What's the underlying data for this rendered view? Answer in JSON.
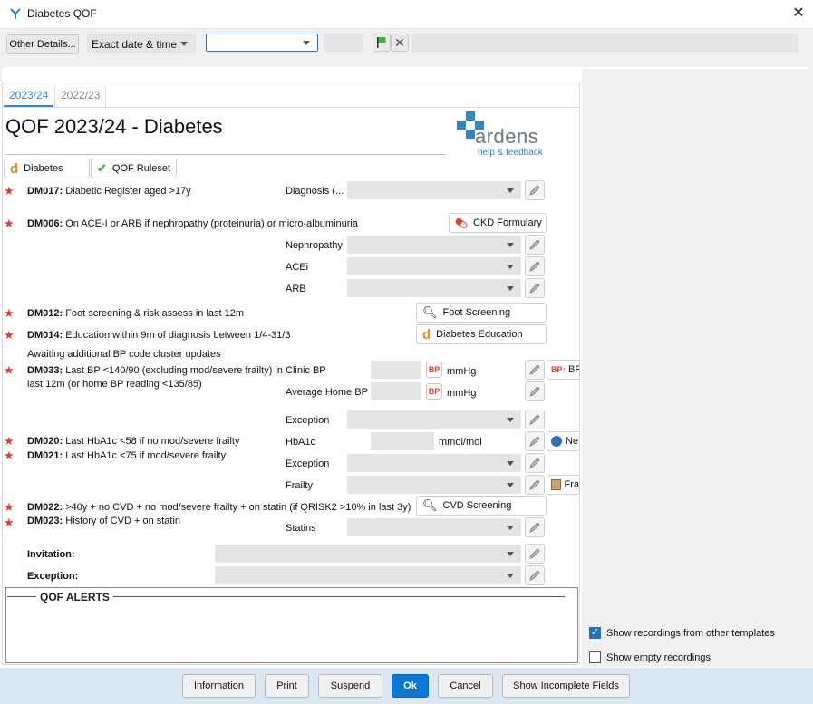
{
  "window": {
    "title": "Diabetes QOF"
  },
  "toolbar": {
    "other_details": "Other Details...",
    "date_mode": "Exact date & time",
    "date_value": "",
    "time_value": "",
    "free_text": ""
  },
  "tabs": [
    {
      "label": "2023/24"
    },
    {
      "label": "2022/23"
    }
  ],
  "page_title": "QOF 2023/24 - Diabetes",
  "logo": {
    "name": "ardens",
    "sub": "help & feedback"
  },
  "top_buttons": {
    "diabetes": "Diabetes",
    "ruleset": "QOF Ruleset"
  },
  "rules": {
    "dm017": {
      "code": "DM017:",
      "text": "Diabetic Register aged >17y"
    },
    "dm006": {
      "code": "DM006:",
      "text": "On ACE-I or ARB if nephropathy (proteinuria) or micro-albuminuria"
    },
    "dm012": {
      "code": "DM012:",
      "text": "Foot screening & risk assess in last 12m"
    },
    "dm014": {
      "code": "DM014:",
      "text": "Education within 9m of diagnosis between 1/4-31/3"
    },
    "bp_note": "Awaiting additional BP code cluster updates",
    "dm033_line1": {
      "code": "DM033:",
      "text": "Last BP <140/90 (excluding mod/severe frailty) in"
    },
    "dm033_line2": "last 12m (or home BP reading <135/85)",
    "dm020": {
      "code": "DM020:",
      "text": "Last HbA1c <58 if no mod/severe frailty"
    },
    "dm021": {
      "code": "DM021:",
      "text": "Last HbA1c <75 if mod/severe frailty"
    },
    "dm022": {
      "code": "DM022:",
      "text": ">40y + no CVD + no mod/severe frailty + on statin (if QRISK2 >10% in last 3y)"
    },
    "dm023": {
      "code": "DM023:",
      "text": "History of CVD + on statin"
    }
  },
  "fields": {
    "diagnosis": "Diagnosis (...",
    "nephropathy": "Nephropathy",
    "acei": "ACEi",
    "arb": "ARB",
    "clinic_bp": "Clinic BP",
    "home_bp": "Average Home BP",
    "exception": "Exception",
    "hba1c": "HbA1c",
    "frailty": "Frailty",
    "statins": "Statins",
    "invitation": "Invitation:",
    "exception_bottom": "Exception:",
    "mmhg": "mmHg",
    "mmol": "mmol/mol"
  },
  "side_buttons": {
    "ckd": "CKD Formulary",
    "foot": "Foot Screening",
    "education": "Diabetes Education",
    "bp": "BP",
    "ne": "Ne",
    "fra": "Fra",
    "cvd": "CVD Screening"
  },
  "alerts": {
    "title": "QOF ALERTS"
  },
  "options": {
    "show_other": {
      "label": "Show recordings from other templates",
      "checked": true
    },
    "show_empty": {
      "label": "Show empty recordings",
      "checked": false
    }
  },
  "footer": {
    "information": "Information",
    "print": "Print",
    "suspend": "Suspend",
    "ok": "Ok",
    "cancel": "Cancel",
    "incomplete": "Show Incomplete Fields"
  },
  "colors": {
    "star": "#e53935",
    "accent": "#2f86c8",
    "ok": "#0a78d4",
    "footer": "#dbe8f4"
  }
}
